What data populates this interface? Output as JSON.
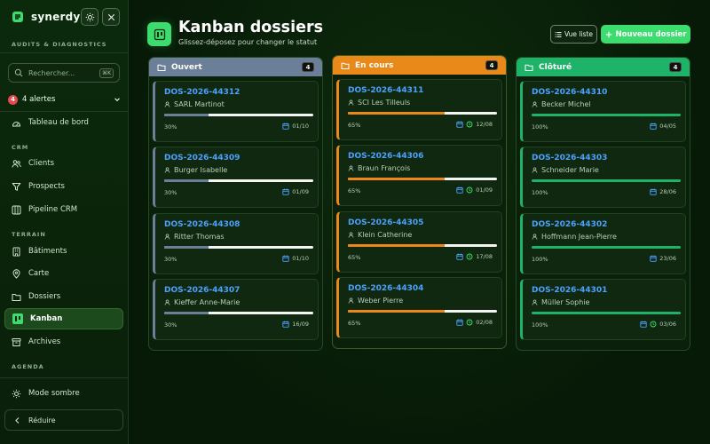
{
  "sidebar": {
    "brand": "synerdys",
    "section_audits": "AUDITS & DIAGNOSTICS",
    "search_placeholder": "Rechercher...",
    "search_shortcut": "⌘K",
    "alerts_count": "4",
    "alerts_label": "4 alertes",
    "dashboard": "Tableau de bord",
    "section_crm": "CRM",
    "clients": "Clients",
    "prospects": "Prospects",
    "pipeline": "Pipeline CRM",
    "section_terrain": "TERRAIN",
    "batiments": "Bâtiments",
    "carte": "Carte",
    "dossiers": "Dossiers",
    "kanban": "Kanban",
    "archives": "Archives",
    "section_agenda": "AGENDA",
    "dark_mode": "Mode sombre",
    "collapse": "Réduire"
  },
  "header": {
    "title": "Kanban dossiers",
    "subtitle": "Glissez-déposez pour changer le statut",
    "list_view": "Vue liste",
    "new_dossier": "Nouveau dossier"
  },
  "colors": {
    "open": "#6c7f98",
    "in_progress": "#e8891a",
    "closed": "#1fb369",
    "accent": "#3ddc6f",
    "link": "#4aa2ff"
  },
  "columns": [
    {
      "name": "Ouvert",
      "count": "4",
      "cards": [
        {
          "id": "DOS-2026-44312",
          "client": "SARL Martinot",
          "progress": 30,
          "progress_label": "30%",
          "date": "01/10"
        },
        {
          "id": "DOS-2026-44309",
          "client": "Burger Isabelle",
          "progress": 30,
          "progress_label": "30%",
          "date": "01/09"
        },
        {
          "id": "DOS-2026-44308",
          "client": "Ritter Thomas",
          "progress": 30,
          "progress_label": "30%",
          "date": "01/10"
        },
        {
          "id": "DOS-2026-44307",
          "client": "Kieffer Anne-Marie",
          "progress": 30,
          "progress_label": "30%",
          "date": "16/09"
        }
      ]
    },
    {
      "name": "En cours",
      "count": "4",
      "cards": [
        {
          "id": "DOS-2026-44311",
          "client": "SCI Les Tilleuls",
          "progress": 65,
          "progress_label": "65%",
          "date": "12/08"
        },
        {
          "id": "DOS-2026-44306",
          "client": "Braun François",
          "progress": 65,
          "progress_label": "65%",
          "date": "01/09"
        },
        {
          "id": "DOS-2026-44305",
          "client": "Klein Catherine",
          "progress": 65,
          "progress_label": "65%",
          "date": "17/08"
        },
        {
          "id": "DOS-2026-44304",
          "client": "Weber Pierre",
          "progress": 65,
          "progress_label": "65%",
          "date": "02/08"
        }
      ]
    },
    {
      "name": "Clôturé",
      "count": "4",
      "cards": [
        {
          "id": "DOS-2026-44310",
          "client": "Becker Michel",
          "progress": 100,
          "progress_label": "100%",
          "date": "04/05"
        },
        {
          "id": "DOS-2026-44303",
          "client": "Schneider Marie",
          "progress": 100,
          "progress_label": "100%",
          "date": "28/06"
        },
        {
          "id": "DOS-2026-44302",
          "client": "Hoffmann Jean-Pierre",
          "progress": 100,
          "progress_label": "100%",
          "date": "23/06"
        },
        {
          "id": "DOS-2026-44301",
          "client": "Müller Sophie",
          "progress": 100,
          "progress_label": "100%",
          "date": "03/06"
        }
      ]
    }
  ]
}
